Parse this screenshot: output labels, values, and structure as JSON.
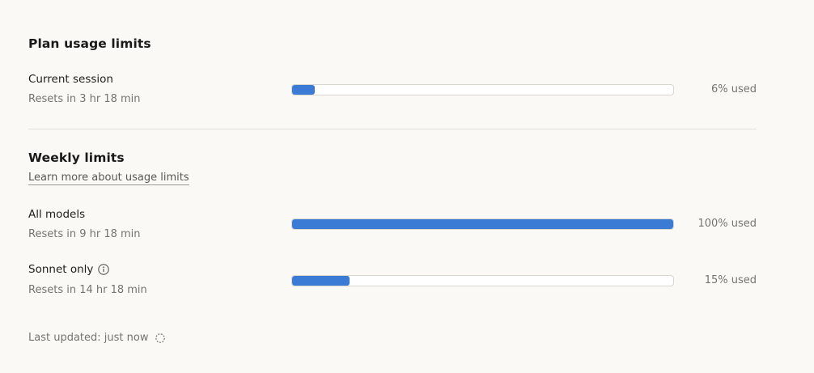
{
  "plan": {
    "title": "Plan usage limits",
    "current_session": {
      "label": "Current session",
      "resets": "Resets in 3 hr 18 min",
      "percent": 6,
      "used_text": "6% used"
    }
  },
  "weekly": {
    "title": "Weekly limits",
    "learn_more": "Learn more about usage limits",
    "all_models": {
      "label": "All models",
      "resets": "Resets in 9 hr 18 min",
      "percent": 100,
      "used_text": "100% used"
    },
    "sonnet_only": {
      "label": "Sonnet only",
      "resets": "Resets in 14 hr 18 min",
      "percent": 15,
      "used_text": "15% used",
      "icon": "info-icon"
    }
  },
  "footer": {
    "last_updated": "Last updated: just now",
    "icon": "refresh-icon"
  },
  "colors": {
    "bar_fill": "#3b7bd6",
    "background": "#faf9f6"
  }
}
